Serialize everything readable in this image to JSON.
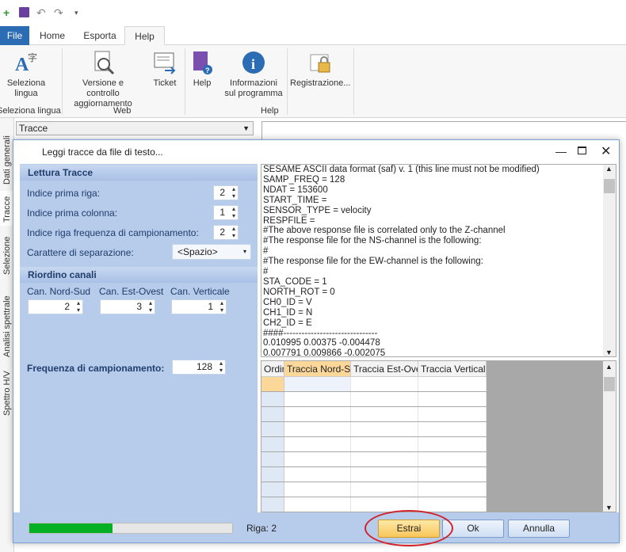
{
  "qat": {
    "icons": [
      "add-icon",
      "save-icon",
      "undo-icon",
      "redo-icon",
      "customize-icon"
    ]
  },
  "tabs": {
    "file": "File",
    "home": "Home",
    "export": "Esporta",
    "help": "Help"
  },
  "ribbon": {
    "select_language": "Seleziona lingua",
    "version_check": "Versione e controllo aggiornamento",
    "ticket": "Ticket",
    "help": "Help",
    "program_info": "Informazioni sul programma",
    "registration": "Registrazione...",
    "group_language": "Seleziona lingua",
    "group_web": "Web",
    "group_help": "Help"
  },
  "side_tabs": [
    "Dati generali",
    "Tracce",
    "Selezione",
    "Analisi spettrale",
    "Spettro H/V"
  ],
  "main": {
    "combo": "Tracce"
  },
  "dialog": {
    "title": "Leggi tracce da file di testo...",
    "section_reading": "Lettura Tracce",
    "first_row_label": "Indice prima riga:",
    "first_row_value": "2",
    "first_col_label": "Indice prima colonna:",
    "first_col_value": "1",
    "freq_row_label": "Indice riga frequenza di campionamento:",
    "freq_row_value": "2",
    "separator_label": "Carattere di separazione:",
    "separator_value": "<Spazio>",
    "section_channels": "Riordino canali",
    "ns_label": "Can. Nord-Sud",
    "ns_value": "2",
    "ew_label": "Can. Est-Ovest",
    "ew_value": "3",
    "vert_label": "Can. Verticale",
    "vert_value": "1",
    "freq_label": "Frequenza di campionamento:",
    "freq_value": "128",
    "text_lines": [
      "SESAME ASCII data format (saf) v. 1    (this line must not be modified)",
      "SAMP_FREQ = 128",
      "NDAT = 153600",
      "START_TIME =",
      "SENSOR_TYPE = velocity",
      "RESPFILE =",
      "#The above response file is correlated only to the Z-channel",
      "#The response file for the NS-channel is the following:",
      "#",
      "#The response file for the EW-channel is the following:",
      "#",
      "STA_CODE = 1",
      "NORTH_ROT = 0",
      "CH0_ID = V",
      "CH1_ID = N",
      "CH2_ID = E",
      "####-------------------------------",
      "0.010995 0.00375 -0.004478",
      "0.007791 0.009866 -0.002075"
    ],
    "grid_headers": [
      "Ordir",
      "Traccia Nord-Sud",
      "Traccia Est-Ovest",
      "Traccia Verticale"
    ],
    "progress": 0.41,
    "status": "Riga: 2",
    "btn_extract": "Estrai",
    "btn_ok": "Ok",
    "btn_cancel": "Annulla"
  }
}
